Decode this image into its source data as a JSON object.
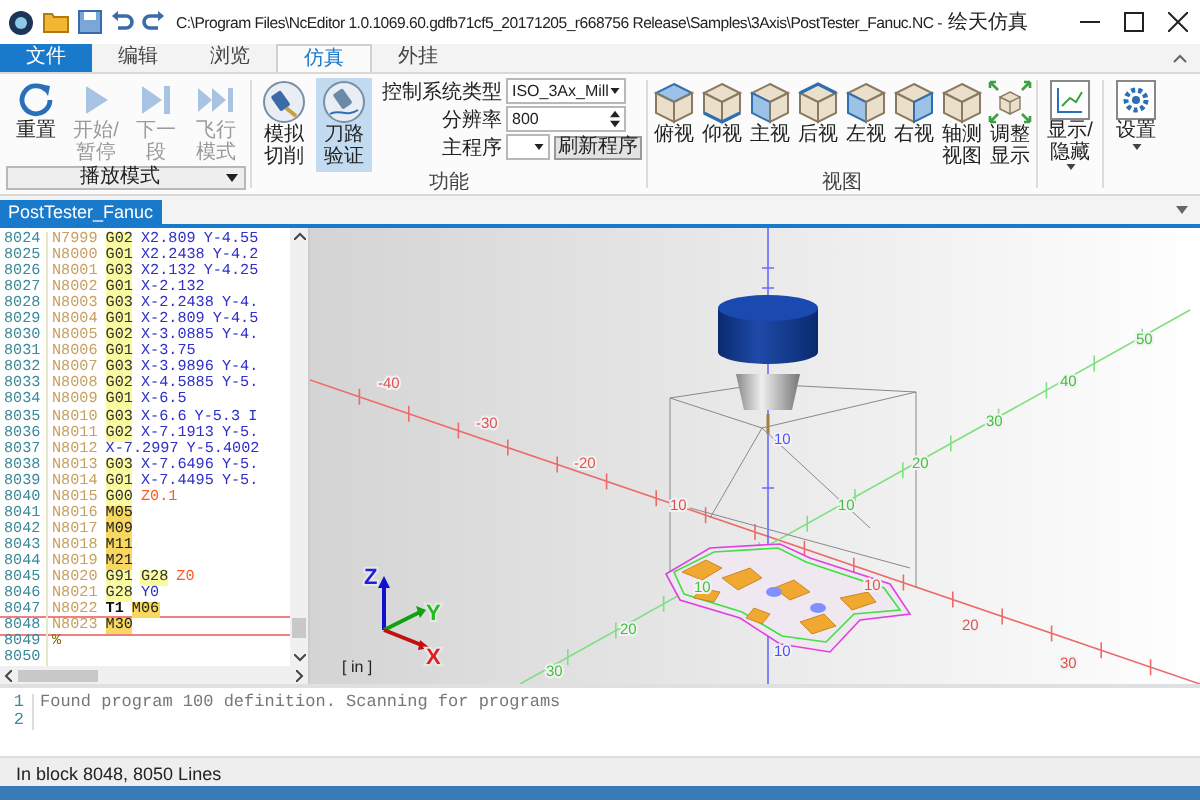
{
  "window": {
    "title_path": "C:\\Program Files\\NcEditor 1.0.1069.60.gdfb71cf5_20171205_r668756 Release\\Samples\\3Axis\\PostTester_Fanuc.NC -",
    "app_name": "绘天仿真"
  },
  "ribbon_tabs": [
    {
      "label": "文件",
      "kind": "file",
      "selected": false
    },
    {
      "label": "编辑",
      "kind": "tab",
      "selected": false
    },
    {
      "label": "浏览",
      "kind": "tab",
      "selected": false
    },
    {
      "label": "仿真",
      "kind": "tab",
      "selected": true
    },
    {
      "label": "外挂",
      "kind": "tab",
      "selected": false
    }
  ],
  "playback": {
    "buttons": [
      {
        "label": "重置",
        "kind": "reset",
        "disabled": false
      },
      {
        "label": "开始/暂停",
        "kind": "play",
        "disabled": true
      },
      {
        "label": "下一段",
        "kind": "next",
        "disabled": true
      },
      {
        "label": "飞行模式",
        "kind": "fly",
        "disabled": true
      }
    ],
    "mode_dropdown": "播放模式"
  },
  "function_group": {
    "label": "功能",
    "buttons": [
      {
        "label": "模拟切削",
        "kind": "cut",
        "selected": false
      },
      {
        "label": "刀路验证",
        "kind": "verify",
        "selected": true
      }
    ],
    "fields": [
      {
        "label": "控制系统类型",
        "kind": "dropdown",
        "value": "ISO_3Ax_Mill"
      },
      {
        "label": "分辨率",
        "kind": "spinner",
        "value": "800"
      },
      {
        "label": "主程序",
        "kind": "combo_button",
        "button": "刷新程序"
      }
    ]
  },
  "view_group": {
    "label": "视图",
    "buttons": [
      {
        "label": "俯视",
        "kind": "top"
      },
      {
        "label": "仰视",
        "kind": "bottom"
      },
      {
        "label": "主视",
        "kind": "front"
      },
      {
        "label": "后视",
        "kind": "back"
      },
      {
        "label": "左视",
        "kind": "left"
      },
      {
        "label": "右视",
        "kind": "right"
      },
      {
        "label": "轴测视图",
        "kind": "iso"
      },
      {
        "label": "调整显示",
        "kind": "fit"
      }
    ]
  },
  "extra_buttons": [
    {
      "label": "显示/隐藏",
      "kind": "chart"
    },
    {
      "label": "设置",
      "kind": "gear"
    }
  ],
  "doc_tabs": [
    {
      "label": "PostTester_Fanuc",
      "selected": true
    }
  ],
  "editor": {
    "lines": [
      {
        "num": "8024",
        "current": false,
        "tokens": [
          {
            "kind": "n",
            "text": "N7999"
          },
          {
            "kind": "g",
            "text": "G02"
          },
          {
            "kind": "c",
            "text": "X2.809"
          },
          {
            "kind": "c",
            "text": "Y-4.55"
          }
        ]
      },
      {
        "num": "8025",
        "current": false,
        "tokens": [
          {
            "kind": "n",
            "text": "N8000"
          },
          {
            "kind": "g",
            "text": "G01"
          },
          {
            "kind": "c",
            "text": "X2.2438"
          },
          {
            "kind": "c",
            "text": "Y-4.2"
          }
        ]
      },
      {
        "num": "8026",
        "current": false,
        "tokens": [
          {
            "kind": "n",
            "text": "N8001"
          },
          {
            "kind": "g",
            "text": "G03"
          },
          {
            "kind": "c",
            "text": "X2.132"
          },
          {
            "kind": "c",
            "text": "Y-4.25"
          }
        ]
      },
      {
        "num": "8027",
        "current": false,
        "tokens": [
          {
            "kind": "n",
            "text": "N8002"
          },
          {
            "kind": "g",
            "text": "G01"
          },
          {
            "kind": "c",
            "text": "X-2.132"
          }
        ]
      },
      {
        "num": "8028",
        "current": false,
        "tokens": [
          {
            "kind": "n",
            "text": "N8003"
          },
          {
            "kind": "g",
            "text": "G03"
          },
          {
            "kind": "c",
            "text": "X-2.2438"
          },
          {
            "kind": "c",
            "text": "Y-4."
          }
        ]
      },
      {
        "num": "8029",
        "current": false,
        "tokens": [
          {
            "kind": "n",
            "text": "N8004"
          },
          {
            "kind": "g",
            "text": "G01"
          },
          {
            "kind": "c",
            "text": "X-2.809"
          },
          {
            "kind": "c",
            "text": "Y-4.5"
          }
        ]
      },
      {
        "num": "8030",
        "current": false,
        "tokens": [
          {
            "kind": "n",
            "text": "N8005"
          },
          {
            "kind": "g",
            "text": "G02"
          },
          {
            "kind": "c",
            "text": "X-3.0885"
          },
          {
            "kind": "c",
            "text": "Y-4."
          }
        ]
      },
      {
        "num": "8031",
        "current": false,
        "tokens": [
          {
            "kind": "n",
            "text": "N8006"
          },
          {
            "kind": "g",
            "text": "G01"
          },
          {
            "kind": "c",
            "text": "X-3.75"
          }
        ]
      },
      {
        "num": "8032",
        "current": false,
        "tokens": [
          {
            "kind": "n",
            "text": "N8007"
          },
          {
            "kind": "g",
            "text": "G03"
          },
          {
            "kind": "c",
            "text": "X-3.9896"
          },
          {
            "kind": "c",
            "text": "Y-4."
          }
        ]
      },
      {
        "num": "8033",
        "current": false,
        "tokens": [
          {
            "kind": "n",
            "text": "N8008"
          },
          {
            "kind": "g",
            "text": "G02"
          },
          {
            "kind": "c",
            "text": "X-4.5885"
          },
          {
            "kind": "c",
            "text": "Y-5."
          }
        ]
      },
      {
        "num": "8034",
        "current": false,
        "tokens": [
          {
            "kind": "n",
            "text": "N8009"
          },
          {
            "kind": "g",
            "text": "G01"
          },
          {
            "kind": "c",
            "text": "X-6.5"
          }
        ]
      },
      {
        "num": "8035",
        "current": false,
        "tokens": [
          {
            "kind": "n",
            "text": "N8010"
          },
          {
            "kind": "g",
            "text": "G03"
          },
          {
            "kind": "c",
            "text": "X-6.6"
          },
          {
            "kind": "c",
            "text": "Y-5.3"
          },
          {
            "kind": "c",
            "text": "I"
          }
        ]
      },
      {
        "num": "8036",
        "current": false,
        "tokens": [
          {
            "kind": "n",
            "text": "N8011"
          },
          {
            "kind": "g",
            "text": "G02"
          },
          {
            "kind": "c",
            "text": "X-7.1913"
          },
          {
            "kind": "c",
            "text": "Y-5."
          }
        ]
      },
      {
        "num": "8037",
        "current": false,
        "tokens": [
          {
            "kind": "n",
            "text": "N8012"
          },
          {
            "kind": "c",
            "text": "X-7.2997"
          },
          {
            "kind": "c",
            "text": "Y-5.4002"
          }
        ]
      },
      {
        "num": "8038",
        "current": false,
        "tokens": [
          {
            "kind": "n",
            "text": "N8013"
          },
          {
            "kind": "g",
            "text": "G03"
          },
          {
            "kind": "c",
            "text": "X-7.6496"
          },
          {
            "kind": "c",
            "text": "Y-5."
          }
        ]
      },
      {
        "num": "8039",
        "current": false,
        "tokens": [
          {
            "kind": "n",
            "text": "N8014"
          },
          {
            "kind": "g",
            "text": "G01"
          },
          {
            "kind": "c",
            "text": "X-7.4495"
          },
          {
            "kind": "c",
            "text": "Y-5."
          }
        ]
      },
      {
        "num": "8040",
        "current": false,
        "tokens": [
          {
            "kind": "n",
            "text": "N8015"
          },
          {
            "kind": "g",
            "text": "G00"
          },
          {
            "kind": "z",
            "text": "Z0.1"
          }
        ]
      },
      {
        "num": "8041",
        "current": false,
        "tokens": [
          {
            "kind": "n",
            "text": "N8016"
          },
          {
            "kind": "m",
            "text": "M05"
          }
        ]
      },
      {
        "num": "8042",
        "current": false,
        "tokens": [
          {
            "kind": "n",
            "text": "N8017"
          },
          {
            "kind": "m",
            "text": "M09"
          }
        ]
      },
      {
        "num": "8043",
        "current": false,
        "tokens": [
          {
            "kind": "n",
            "text": "N8018"
          },
          {
            "kind": "m",
            "text": "M11"
          }
        ]
      },
      {
        "num": "8044",
        "current": false,
        "tokens": [
          {
            "kind": "n",
            "text": "N8019"
          },
          {
            "kind": "m",
            "text": "M21"
          }
        ]
      },
      {
        "num": "8045",
        "current": false,
        "tokens": [
          {
            "kind": "n",
            "text": "N8020"
          },
          {
            "kind": "g",
            "text": "G91"
          },
          {
            "kind": "g",
            "text": "G28"
          },
          {
            "kind": "z",
            "text": "Z0"
          }
        ]
      },
      {
        "num": "8046",
        "current": false,
        "tokens": [
          {
            "kind": "n",
            "text": "N8021"
          },
          {
            "kind": "g",
            "text": "G28"
          },
          {
            "kind": "c",
            "text": "Y0"
          }
        ]
      },
      {
        "num": "8047",
        "current": false,
        "tokens": [
          {
            "kind": "n",
            "text": "N8022"
          },
          {
            "kind": "t",
            "text": "T1"
          },
          {
            "kind": "m",
            "text": "M06"
          }
        ]
      },
      {
        "num": "8048",
        "current": true,
        "tokens": [
          {
            "kind": "n",
            "text": "N8023"
          },
          {
            "kind": "m",
            "text": "M30"
          }
        ]
      },
      {
        "num": "8049",
        "current": false,
        "tokens": [
          {
            "kind": "p",
            "text": "%"
          }
        ]
      },
      {
        "num": "8050",
        "current": false
      }
    ]
  },
  "viewport": {
    "x_axis_labels": [
      "-40",
      "-30",
      "-20",
      "10",
      "10",
      "20",
      "30"
    ],
    "y_axis_labels": [
      "30",
      "20",
      "10",
      "10",
      "20",
      "30",
      "40",
      "50"
    ],
    "z_axis_labels": [
      "10",
      "10"
    ],
    "triad_labels": [
      "X",
      "Y",
      "Z"
    ],
    "units": "[ in ]"
  },
  "output": {
    "lines": [
      {
        "num": "1",
        "text": "Found program 100 definition. Scanning for programs"
      },
      {
        "num": "2"
      }
    ]
  },
  "status_bar": "In block 8048, 8050 Lines"
}
